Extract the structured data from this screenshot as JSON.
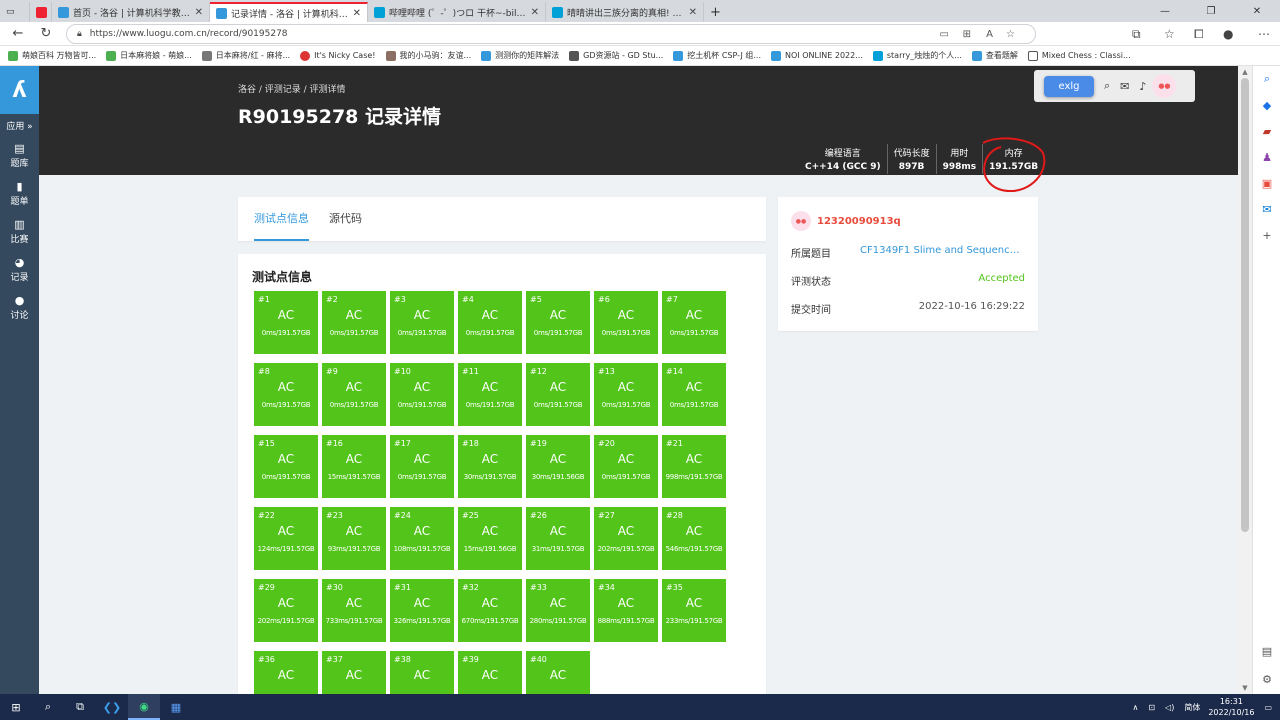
{
  "browser": {
    "tabs": [
      {
        "label": "首页 - 洛谷 | 计算机科学教育新生态",
        "color": "#3498db",
        "active": false
      },
      {
        "label": "记录详情 - 洛谷 | 计算机科学教育新生态",
        "color": "#3498db",
        "active": true
      },
      {
        "label": "哔哩哔哩 (゜-゜)つロ 干杯~-bilibili",
        "color": "#00a1d6",
        "active": false
      },
      {
        "label": "晴晴讲出三族分离的真相! 新的",
        "color": "#00a1d6",
        "active": false
      }
    ],
    "new_tab": "+",
    "url": "https://www.luogu.com.cn/record/90195278",
    "bookmarks": [
      "萌娘百科 万物皆可...",
      "日本麻将娘 - 萌娘...",
      "日本麻将/红 - 麻将...",
      "It's Nicky Case!",
      "我的小马驹：友谊...",
      "测测你的矩阵解法",
      "GD资源站 - GD Stu...",
      "挖土机杯 CSP-J 组...",
      "NOI ONLINE 2022...",
      "starry_烛烛的个人...",
      "查看题解",
      "Mixed Chess : Classi..."
    ]
  },
  "sidebar": {
    "logo": "ʎ",
    "items": [
      {
        "icon": "⠿",
        "label": "应用 »"
      },
      {
        "icon": "▤",
        "label": "题库"
      },
      {
        "icon": "▮",
        "label": "题单"
      },
      {
        "icon": "▥",
        "label": "比赛"
      },
      {
        "icon": "◕",
        "label": "记录"
      },
      {
        "icon": "●",
        "label": "讨论"
      }
    ]
  },
  "header": {
    "breadcrumb": "洛谷 / 评测记录 / 评测详情",
    "title": "R90195278 记录详情",
    "exlg": "exlg",
    "stats": [
      {
        "label": "编程语言",
        "value": "C++14 (GCC 9)"
      },
      {
        "label": "代码长度",
        "value": "897B"
      },
      {
        "label": "用时",
        "value": "998ms"
      },
      {
        "label": "内存",
        "value": "191.57GB"
      }
    ]
  },
  "tabs": [
    "测试点信息",
    "源代码"
  ],
  "testcases_title": "测试点信息",
  "testcases": [
    {
      "id": "#1",
      "status": "AC",
      "meta": "0ms/191.57GB"
    },
    {
      "id": "#2",
      "status": "AC",
      "meta": "0ms/191.57GB"
    },
    {
      "id": "#3",
      "status": "AC",
      "meta": "0ms/191.57GB"
    },
    {
      "id": "#4",
      "status": "AC",
      "meta": "0ms/191.57GB"
    },
    {
      "id": "#5",
      "status": "AC",
      "meta": "0ms/191.57GB"
    },
    {
      "id": "#6",
      "status": "AC",
      "meta": "0ms/191.57GB"
    },
    {
      "id": "#7",
      "status": "AC",
      "meta": "0ms/191.57GB"
    },
    {
      "id": "#8",
      "status": "AC",
      "meta": "0ms/191.57GB"
    },
    {
      "id": "#9",
      "status": "AC",
      "meta": "0ms/191.57GB"
    },
    {
      "id": "#10",
      "status": "AC",
      "meta": "0ms/191.57GB"
    },
    {
      "id": "#11",
      "status": "AC",
      "meta": "0ms/191.57GB"
    },
    {
      "id": "#12",
      "status": "AC",
      "meta": "0ms/191.57GB"
    },
    {
      "id": "#13",
      "status": "AC",
      "meta": "0ms/191.57GB"
    },
    {
      "id": "#14",
      "status": "AC",
      "meta": "0ms/191.57GB"
    },
    {
      "id": "#15",
      "status": "AC",
      "meta": "0ms/191.57GB"
    },
    {
      "id": "#16",
      "status": "AC",
      "meta": "15ms/191.57GB"
    },
    {
      "id": "#17",
      "status": "AC",
      "meta": "0ms/191.57GB"
    },
    {
      "id": "#18",
      "status": "AC",
      "meta": "30ms/191.57GB"
    },
    {
      "id": "#19",
      "status": "AC",
      "meta": "30ms/191.56GB"
    },
    {
      "id": "#20",
      "status": "AC",
      "meta": "0ms/191.57GB"
    },
    {
      "id": "#21",
      "status": "AC",
      "meta": "998ms/191.57GB"
    },
    {
      "id": "#22",
      "status": "AC",
      "meta": "124ms/191.57GB"
    },
    {
      "id": "#23",
      "status": "AC",
      "meta": "93ms/191.57GB"
    },
    {
      "id": "#24",
      "status": "AC",
      "meta": "108ms/191.57GB"
    },
    {
      "id": "#25",
      "status": "AC",
      "meta": "15ms/191.56GB"
    },
    {
      "id": "#26",
      "status": "AC",
      "meta": "31ms/191.57GB"
    },
    {
      "id": "#27",
      "status": "AC",
      "meta": "202ms/191.57GB"
    },
    {
      "id": "#28",
      "status": "AC",
      "meta": "546ms/191.57GB"
    },
    {
      "id": "#29",
      "status": "AC",
      "meta": "202ms/191.57GB"
    },
    {
      "id": "#30",
      "status": "AC",
      "meta": "733ms/191.57GB"
    },
    {
      "id": "#31",
      "status": "AC",
      "meta": "326ms/191.57GB"
    },
    {
      "id": "#32",
      "status": "AC",
      "meta": "670ms/191.57GB"
    },
    {
      "id": "#33",
      "status": "AC",
      "meta": "280ms/191.57GB"
    },
    {
      "id": "#34",
      "status": "AC",
      "meta": "888ms/191.57GB"
    },
    {
      "id": "#35",
      "status": "AC",
      "meta": "233ms/191.57GB"
    },
    {
      "id": "#36",
      "status": "AC",
      "meta": ""
    },
    {
      "id": "#37",
      "status": "AC",
      "meta": ""
    },
    {
      "id": "#38",
      "status": "AC",
      "meta": ""
    },
    {
      "id": "#39",
      "status": "AC",
      "meta": ""
    },
    {
      "id": "#40",
      "status": "AC",
      "meta": ""
    }
  ],
  "info": {
    "username": "12320090913q",
    "rows": [
      {
        "key": "所属题目",
        "value": "CF1349F1 Slime and Sequence...",
        "color": "#3498db"
      },
      {
        "key": "评测状态",
        "value": "Accepted",
        "color": "#52c41a"
      },
      {
        "key": "提交时间",
        "value": "2022-10-16 16:29:22",
        "color": "#555"
      }
    ]
  },
  "taskbar": {
    "ime": "简体",
    "time": "16:31",
    "date": "2022/10/16"
  },
  "colors": {
    "ac": "#52c41a",
    "accent": "#3498db",
    "header": "#2b2b2b",
    "sidebar": "#34495e",
    "username": "#e74c3c"
  }
}
